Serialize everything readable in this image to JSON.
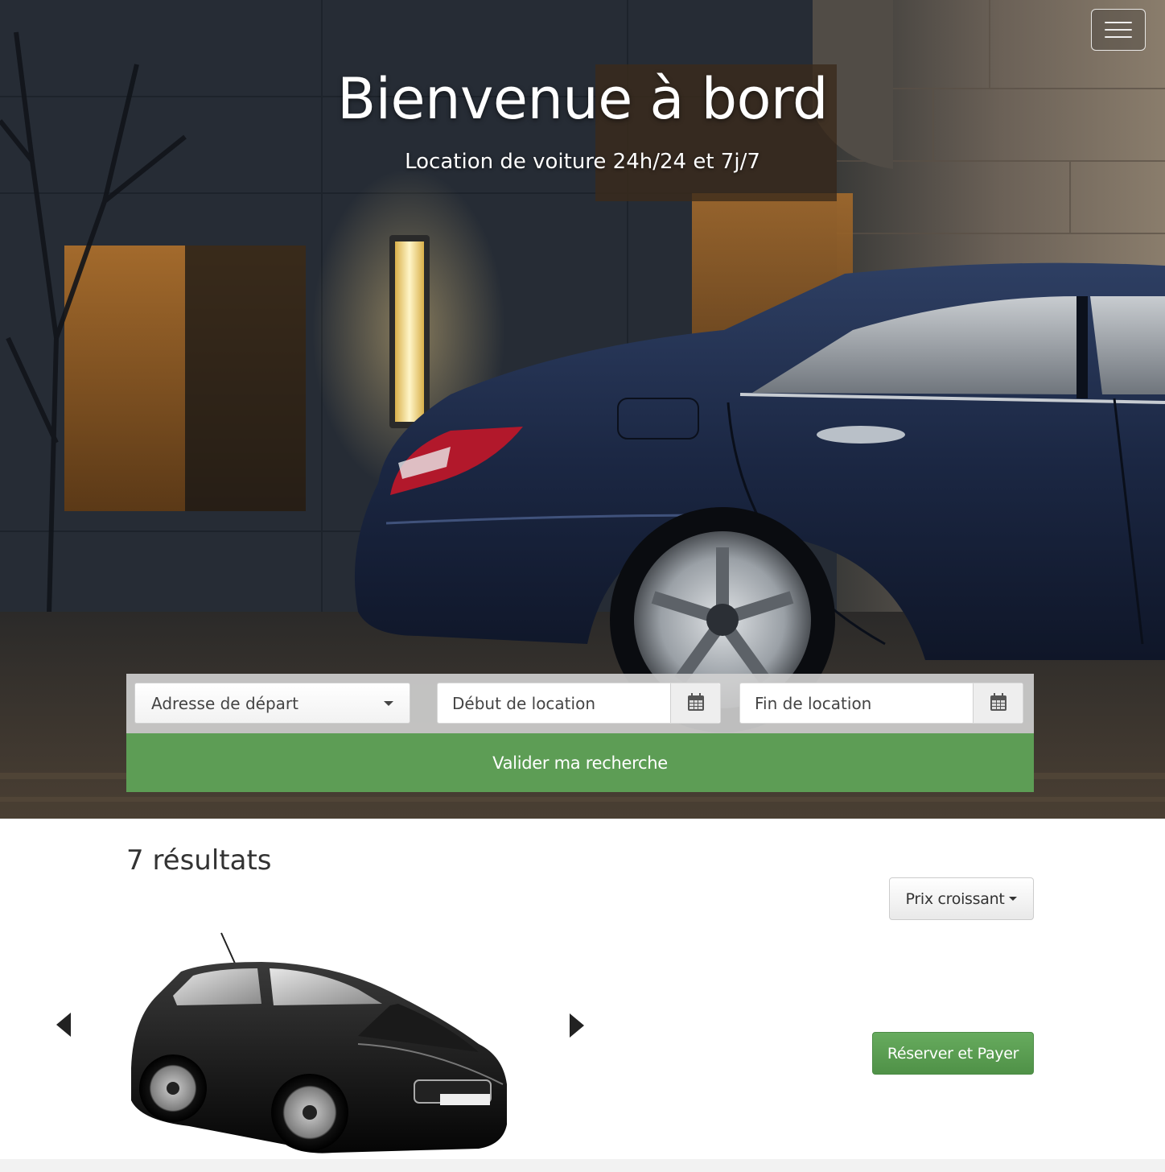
{
  "hero": {
    "title": "Bienvenue à bord",
    "subtitle": "Location de voiture 24h/24 et 7j/7"
  },
  "nav": {
    "menu_icon": "hamburger-menu-icon"
  },
  "search": {
    "address_label": "Adresse de départ",
    "start_placeholder": "Début de location",
    "end_placeholder": "Fin de location",
    "calendar_icon": "calendar-icon",
    "submit_label": "Valider ma recherche"
  },
  "results": {
    "count_label": "7 résultats",
    "sort_label": "Prix croissant",
    "book_label": "Réserver et Payer"
  },
  "colors": {
    "accent_green": "#5d9d55",
    "text_dark": "#333333"
  }
}
